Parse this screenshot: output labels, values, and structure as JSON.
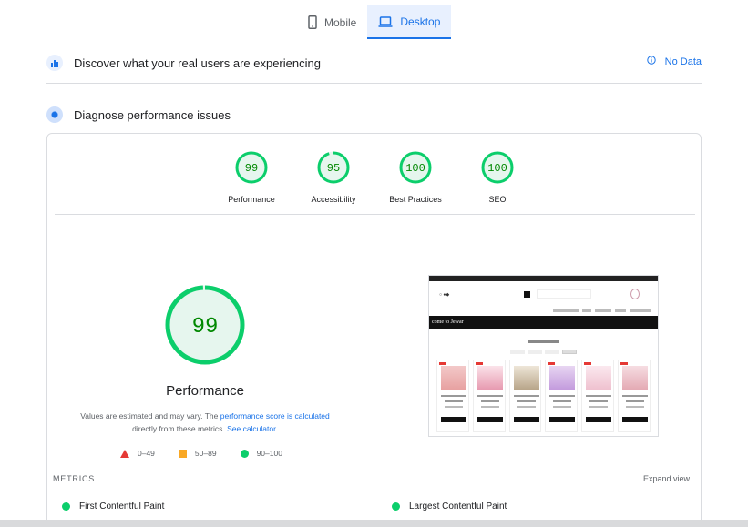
{
  "tabs": [
    {
      "label": "Mobile",
      "icon": "phone-icon",
      "active": false
    },
    {
      "label": "Desktop",
      "icon": "laptop-icon",
      "active": true
    }
  ],
  "crux": {
    "title": "Discover what your real users are experiencing",
    "status": "No Data",
    "icon": "users-chart-icon"
  },
  "diagnose": {
    "title": "Diagnose performance issues",
    "icon": "lighthouse-icon"
  },
  "scores": [
    {
      "label": "Performance",
      "value": "99",
      "fraction": 0.99
    },
    {
      "label": "Accessibility",
      "value": "95",
      "fraction": 0.95
    },
    {
      "label": "Best Practices",
      "value": "100",
      "fraction": 1.0
    },
    {
      "label": "SEO",
      "value": "100",
      "fraction": 1.0
    }
  ],
  "performance": {
    "score": "99",
    "fraction": 0.99,
    "title": "Performance",
    "note_prefix": "Values are estimated and may vary. The ",
    "note_link1": "performance score is calculated",
    "note_mid": " directly from these metrics. ",
    "note_link2": "See calculator."
  },
  "legend": [
    {
      "range": "0–49",
      "shape": "triangle",
      "color": "#e53935"
    },
    {
      "range": "50–89",
      "shape": "square",
      "color": "#f9a825"
    },
    {
      "range": "90–100",
      "shape": "circle",
      "color": "#0cce6b"
    }
  ],
  "screenshot": {
    "banner_text": "come to Jewar"
  },
  "metrics": {
    "label": "METRICS",
    "expand": "Expand view",
    "items": [
      {
        "name": "First Contentful Paint",
        "status": "good"
      },
      {
        "name": "Largest Contentful Paint",
        "status": "good"
      }
    ]
  },
  "colors": {
    "pass": "#0cce6b",
    "pass_text": "#008800",
    "pass_fill": "#e6f6ee",
    "accent": "#1a73e8"
  }
}
